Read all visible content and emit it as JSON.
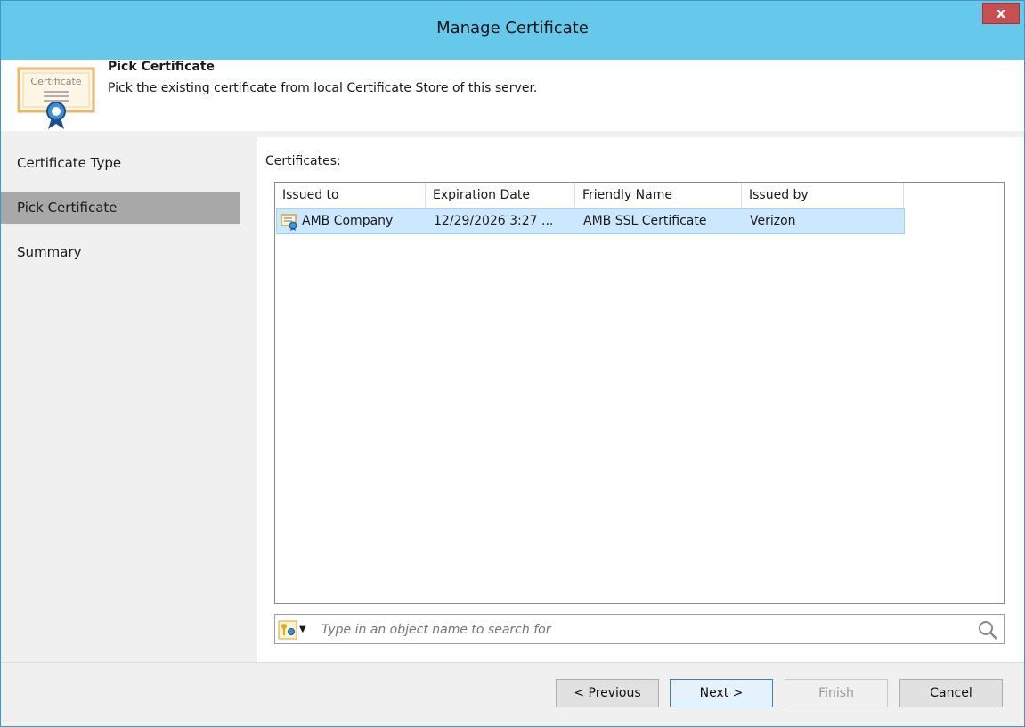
{
  "window": {
    "title": "Manage Certificate",
    "close_label": "x"
  },
  "header": {
    "title": "Pick Certificate",
    "subtitle": "Pick the existing certificate from local Certificate Store of this server.",
    "icon_text": "Certificate"
  },
  "nav": {
    "items": [
      {
        "label": "Certificate Type"
      },
      {
        "label": "Pick Certificate"
      },
      {
        "label": "Summary"
      }
    ]
  },
  "certificates": {
    "label": "Certificates:",
    "columns": [
      "Issued to",
      "Expiration Date",
      "Friendly Name",
      "Issued by"
    ],
    "rows": [
      {
        "issued_to": "AMB Company",
        "expiration": "12/29/2026 3:27 ...",
        "friendly_name": "AMB SSL Certificate",
        "issued_by": "Verizon"
      }
    ]
  },
  "search": {
    "placeholder": "Type in an object name to search for"
  },
  "buttons": {
    "previous": "< Previous",
    "next": "Next >",
    "finish": "Finish",
    "cancel": "Cancel"
  },
  "colors": {
    "titlebar": "#66c8eb",
    "selection": "#cce8ff",
    "nav_selected": "#a8a8a8"
  }
}
